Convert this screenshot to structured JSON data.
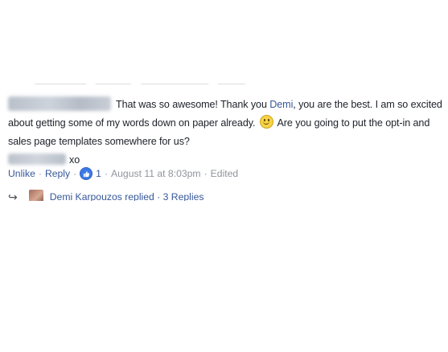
{
  "comment": {
    "text_part1": "That was so awesome! Thank you ",
    "mention": "Demi",
    "text_part2": ", you are the best. I am so excited about getting some of my words down on paper already. ",
    "emoji_icon": "smile-emoji",
    "text_part3": " Are you going to put the opt-in and sales page templates somewhere for us?",
    "signoff": "xo"
  },
  "actions": {
    "unlike": "Unlike",
    "dot": "·",
    "reply": "Reply",
    "like_count": "1",
    "timestamp": "August 11 at 8:03pm",
    "edited": "Edited"
  },
  "replies": {
    "summary": "Demi Karpouzos replied · 3 Replies"
  },
  "colors": {
    "link": "#365899",
    "meta": "#90949c",
    "text": "#1d2129",
    "like_badge": "#3b7ae6"
  }
}
